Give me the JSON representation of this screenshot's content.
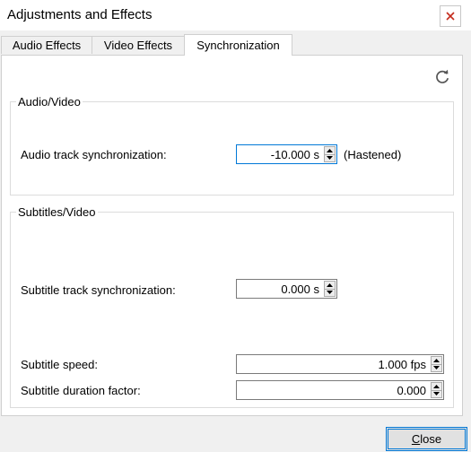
{
  "window": {
    "title": "Adjustments and Effects",
    "close_icon": "close-icon"
  },
  "tabs": [
    {
      "label": "Audio Effects",
      "active": false
    },
    {
      "label": "Video Effects",
      "active": false
    },
    {
      "label": "Synchronization",
      "active": true
    }
  ],
  "toolbar": {
    "reset_icon": "refresh-icon"
  },
  "audio_video": {
    "group_label": "Audio/Video",
    "audio_sync_label": "Audio track synchronization:",
    "audio_sync_value": "-10.000 s",
    "audio_sync_status": "(Hastened)"
  },
  "subtitles_video": {
    "group_label": "Subtitles/Video",
    "subtitle_sync_label": "Subtitle track synchronization:",
    "subtitle_sync_value": "0.000 s",
    "subtitle_speed_label": "Subtitle speed:",
    "subtitle_speed_value": "1.000 fps",
    "subtitle_duration_label": "Subtitle duration factor:",
    "subtitle_duration_value": "0.000"
  },
  "footer": {
    "close_first": "C",
    "close_rest": "lose"
  }
}
